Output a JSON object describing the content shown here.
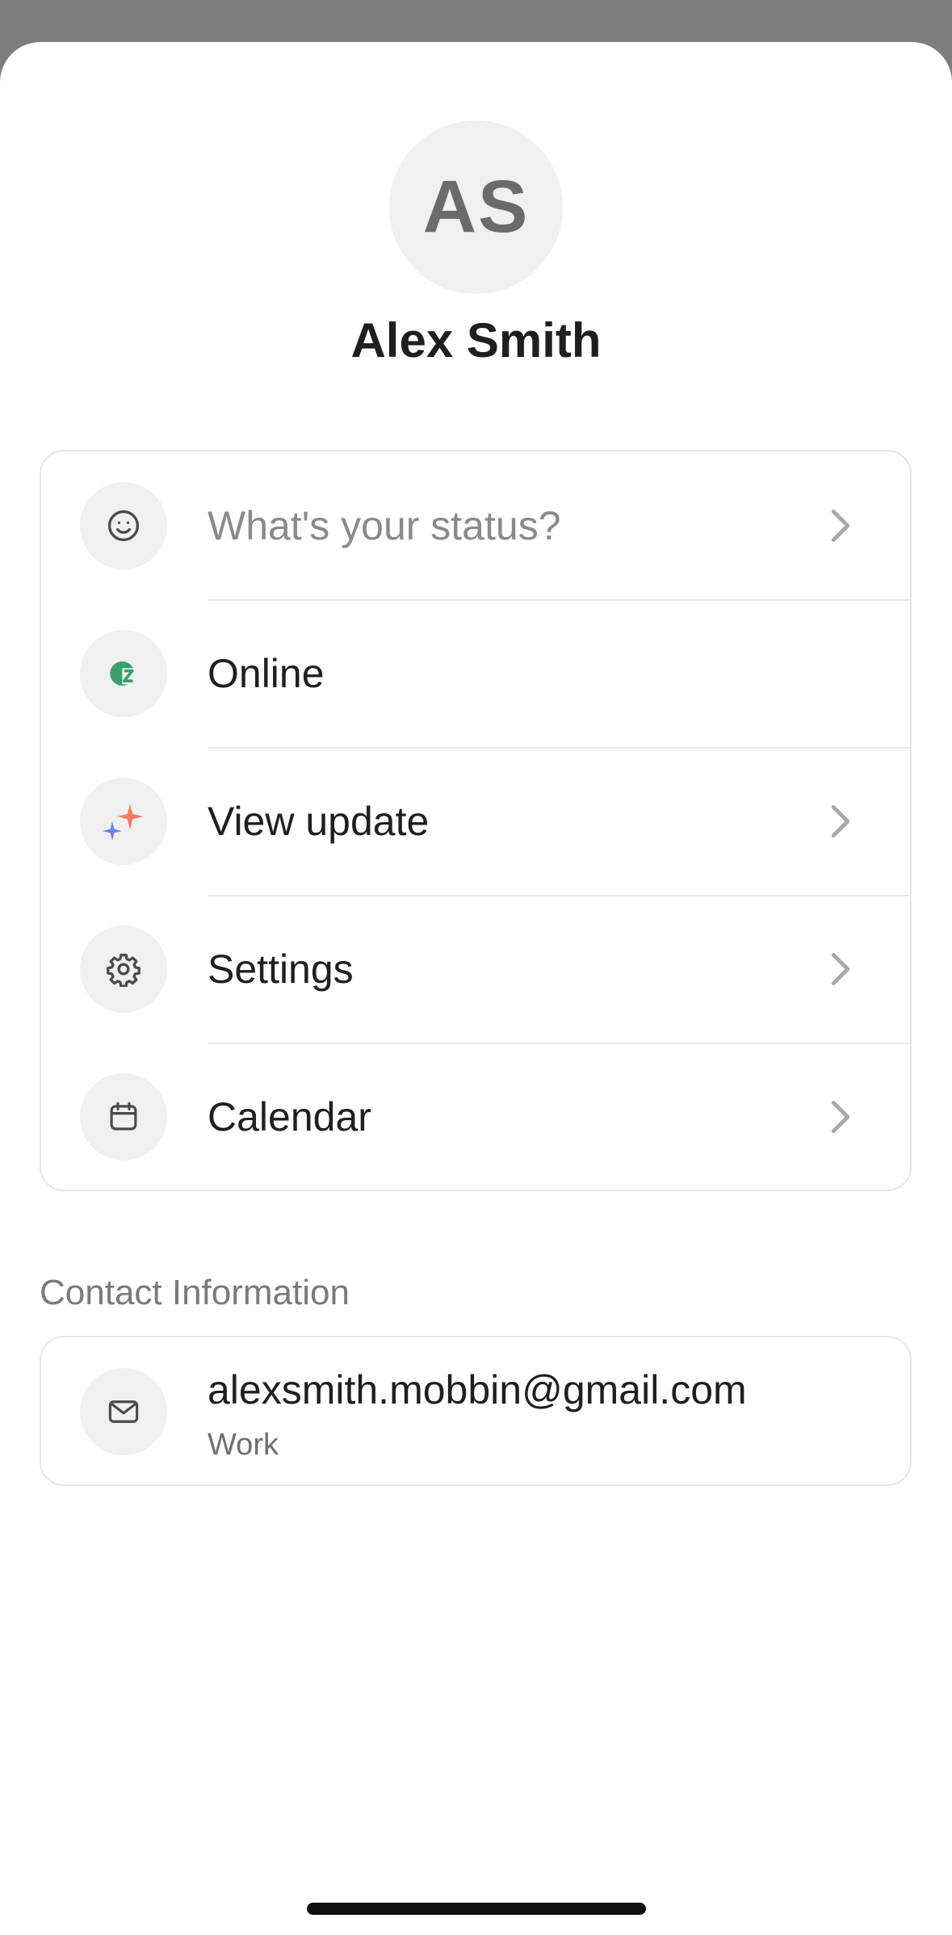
{
  "profile": {
    "initials": "AS",
    "name": "Alex Smith"
  },
  "menu": {
    "items": [
      {
        "label": "What's your status?",
        "icon": "smiley-icon",
        "chevron": true,
        "placeholder": true
      },
      {
        "label": "Online",
        "icon": "online-status-icon",
        "chevron": false,
        "placeholder": false
      },
      {
        "label": "View update",
        "icon": "sparkles-icon",
        "chevron": true,
        "placeholder": false
      },
      {
        "label": "Settings",
        "icon": "gear-icon",
        "chevron": true,
        "placeholder": false
      },
      {
        "label": "Calendar",
        "icon": "calendar-icon",
        "chevron": true,
        "placeholder": false
      }
    ]
  },
  "contact": {
    "section_title": "Contact Information",
    "email": "alexsmith.mobbin@gmail.com",
    "email_type": "Work",
    "icon": "mail-icon"
  },
  "colors": {
    "online_green": "#3a9f6b",
    "sparkle_pink": "#f0557a",
    "sparkle_orange": "#f5a04a",
    "sparkle_blue": "#6a7ff0",
    "backdrop": "#7d7d7d"
  }
}
